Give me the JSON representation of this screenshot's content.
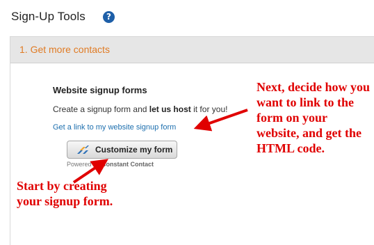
{
  "header": {
    "title": "Sign-Up Tools",
    "help_icon_glyph": "?"
  },
  "panel": {
    "header_label": "1. Get more contacts"
  },
  "signup": {
    "section_title": "Website signup forms",
    "desc_before": "Create a signup form and ",
    "desc_bold": "let us host",
    "desc_after": " it for you!",
    "link_label": "Get a link to my website signup form",
    "button_label": "Customize my form",
    "powered_prefix": "Powered by ",
    "powered_brand": "Constant Contact"
  },
  "annotations": {
    "right_note": "Next, decide how you want to link to the form on your website, and get the HTML code.",
    "left_note": "Start by creating your signup form."
  },
  "colors": {
    "accent_orange": "#e07b24",
    "link_blue": "#1d6fae",
    "annotation_red": "#e00000",
    "help_blue": "#1e5fa8"
  },
  "icons": [
    "question-mark-icon",
    "constant-contact-logo-icon",
    "red-arrow"
  ]
}
